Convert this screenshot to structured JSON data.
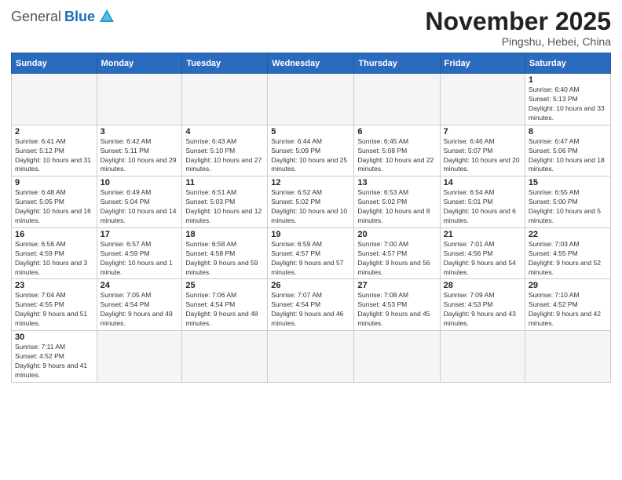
{
  "header": {
    "logo_general": "General",
    "logo_blue": "Blue",
    "month_title": "November 2025",
    "subtitle": "Pingshu, Hebei, China"
  },
  "days_of_week": [
    "Sunday",
    "Monday",
    "Tuesday",
    "Wednesday",
    "Thursday",
    "Friday",
    "Saturday"
  ],
  "weeks": [
    [
      {
        "day": "",
        "info": ""
      },
      {
        "day": "",
        "info": ""
      },
      {
        "day": "",
        "info": ""
      },
      {
        "day": "",
        "info": ""
      },
      {
        "day": "",
        "info": ""
      },
      {
        "day": "",
        "info": ""
      },
      {
        "day": "1",
        "info": "Sunrise: 6:40 AM\nSunset: 5:13 PM\nDaylight: 10 hours and 33 minutes."
      }
    ],
    [
      {
        "day": "2",
        "info": "Sunrise: 6:41 AM\nSunset: 5:12 PM\nDaylight: 10 hours and 31 minutes."
      },
      {
        "day": "3",
        "info": "Sunrise: 6:42 AM\nSunset: 5:11 PM\nDaylight: 10 hours and 29 minutes."
      },
      {
        "day": "4",
        "info": "Sunrise: 6:43 AM\nSunset: 5:10 PM\nDaylight: 10 hours and 27 minutes."
      },
      {
        "day": "5",
        "info": "Sunrise: 6:44 AM\nSunset: 5:09 PM\nDaylight: 10 hours and 25 minutes."
      },
      {
        "day": "6",
        "info": "Sunrise: 6:45 AM\nSunset: 5:08 PM\nDaylight: 10 hours and 22 minutes."
      },
      {
        "day": "7",
        "info": "Sunrise: 6:46 AM\nSunset: 5:07 PM\nDaylight: 10 hours and 20 minutes."
      },
      {
        "day": "8",
        "info": "Sunrise: 6:47 AM\nSunset: 5:06 PM\nDaylight: 10 hours and 18 minutes."
      }
    ],
    [
      {
        "day": "9",
        "info": "Sunrise: 6:48 AM\nSunset: 5:05 PM\nDaylight: 10 hours and 16 minutes."
      },
      {
        "day": "10",
        "info": "Sunrise: 6:49 AM\nSunset: 5:04 PM\nDaylight: 10 hours and 14 minutes."
      },
      {
        "day": "11",
        "info": "Sunrise: 6:51 AM\nSunset: 5:03 PM\nDaylight: 10 hours and 12 minutes."
      },
      {
        "day": "12",
        "info": "Sunrise: 6:52 AM\nSunset: 5:02 PM\nDaylight: 10 hours and 10 minutes."
      },
      {
        "day": "13",
        "info": "Sunrise: 6:53 AM\nSunset: 5:02 PM\nDaylight: 10 hours and 8 minutes."
      },
      {
        "day": "14",
        "info": "Sunrise: 6:54 AM\nSunset: 5:01 PM\nDaylight: 10 hours and 6 minutes."
      },
      {
        "day": "15",
        "info": "Sunrise: 6:55 AM\nSunset: 5:00 PM\nDaylight: 10 hours and 5 minutes."
      }
    ],
    [
      {
        "day": "16",
        "info": "Sunrise: 6:56 AM\nSunset: 4:59 PM\nDaylight: 10 hours and 3 minutes."
      },
      {
        "day": "17",
        "info": "Sunrise: 6:57 AM\nSunset: 4:59 PM\nDaylight: 10 hours and 1 minute."
      },
      {
        "day": "18",
        "info": "Sunrise: 6:58 AM\nSunset: 4:58 PM\nDaylight: 9 hours and 59 minutes."
      },
      {
        "day": "19",
        "info": "Sunrise: 6:59 AM\nSunset: 4:57 PM\nDaylight: 9 hours and 57 minutes."
      },
      {
        "day": "20",
        "info": "Sunrise: 7:00 AM\nSunset: 4:57 PM\nDaylight: 9 hours and 56 minutes."
      },
      {
        "day": "21",
        "info": "Sunrise: 7:01 AM\nSunset: 4:56 PM\nDaylight: 9 hours and 54 minutes."
      },
      {
        "day": "22",
        "info": "Sunrise: 7:03 AM\nSunset: 4:55 PM\nDaylight: 9 hours and 52 minutes."
      }
    ],
    [
      {
        "day": "23",
        "info": "Sunrise: 7:04 AM\nSunset: 4:55 PM\nDaylight: 9 hours and 51 minutes."
      },
      {
        "day": "24",
        "info": "Sunrise: 7:05 AM\nSunset: 4:54 PM\nDaylight: 9 hours and 49 minutes."
      },
      {
        "day": "25",
        "info": "Sunrise: 7:06 AM\nSunset: 4:54 PM\nDaylight: 9 hours and 48 minutes."
      },
      {
        "day": "26",
        "info": "Sunrise: 7:07 AM\nSunset: 4:54 PM\nDaylight: 9 hours and 46 minutes."
      },
      {
        "day": "27",
        "info": "Sunrise: 7:08 AM\nSunset: 4:53 PM\nDaylight: 9 hours and 45 minutes."
      },
      {
        "day": "28",
        "info": "Sunrise: 7:09 AM\nSunset: 4:53 PM\nDaylight: 9 hours and 43 minutes."
      },
      {
        "day": "29",
        "info": "Sunrise: 7:10 AM\nSunset: 4:52 PM\nDaylight: 9 hours and 42 minutes."
      }
    ],
    [
      {
        "day": "30",
        "info": "Sunrise: 7:11 AM\nSunset: 4:52 PM\nDaylight: 9 hours and 41 minutes."
      },
      {
        "day": "",
        "info": ""
      },
      {
        "day": "",
        "info": ""
      },
      {
        "day": "",
        "info": ""
      },
      {
        "day": "",
        "info": ""
      },
      {
        "day": "",
        "info": ""
      },
      {
        "day": "",
        "info": ""
      }
    ]
  ]
}
